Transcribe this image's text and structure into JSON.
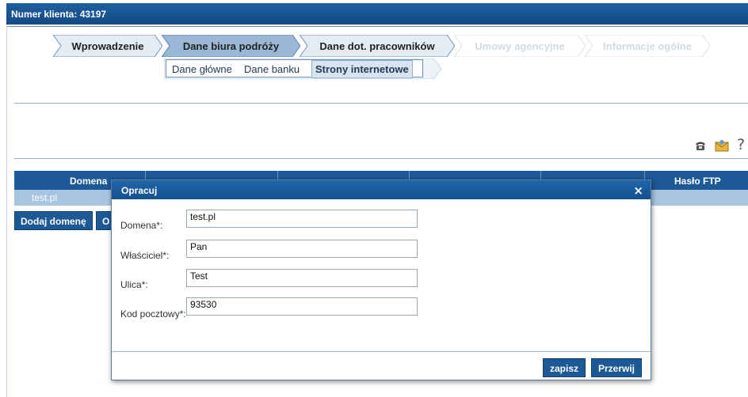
{
  "header": {
    "client_label": "Numer klienta: 43197"
  },
  "wizard": {
    "steps": [
      {
        "label": "Wprowadzenie",
        "state": "done"
      },
      {
        "label": "Dane biura podróży",
        "state": "current"
      },
      {
        "label": "Dane dot. pracowników",
        "state": "done"
      },
      {
        "label": "Umowy agencyjne",
        "state": "disabled"
      },
      {
        "label": "Informacje ogólne",
        "state": "disabled"
      }
    ],
    "substeps": [
      {
        "label": "Dane główne"
      },
      {
        "label": "Dane banku"
      },
      {
        "label": "Strony internetowe",
        "active": true
      }
    ]
  },
  "toolbar_icons": {
    "phone": "phone-icon",
    "mail": "mail-icon",
    "help": "?"
  },
  "table": {
    "columns": [
      "Domena",
      "Hasło FTP"
    ],
    "rows": [
      {
        "domain": "test.pl"
      }
    ]
  },
  "actions": {
    "add_domain": "Dodaj domenę",
    "second": "O"
  },
  "modal": {
    "title": "Opracuj",
    "close": "×",
    "fields": [
      {
        "label": "Domena*:",
        "value": "test.pl"
      },
      {
        "label": "Właściciel*:",
        "value": "Pan"
      },
      {
        "label": "Ulica*:",
        "value": "Test"
      },
      {
        "label": "Kod pocztowy*:",
        "value": "93530"
      }
    ],
    "save": "zapisz",
    "cancel": "Przerwij"
  },
  "colors": {
    "primary": "#1d5897",
    "row": "#a9c4e1",
    "step_done": "#e3ebf3",
    "step_current": "#9ab7d5"
  }
}
